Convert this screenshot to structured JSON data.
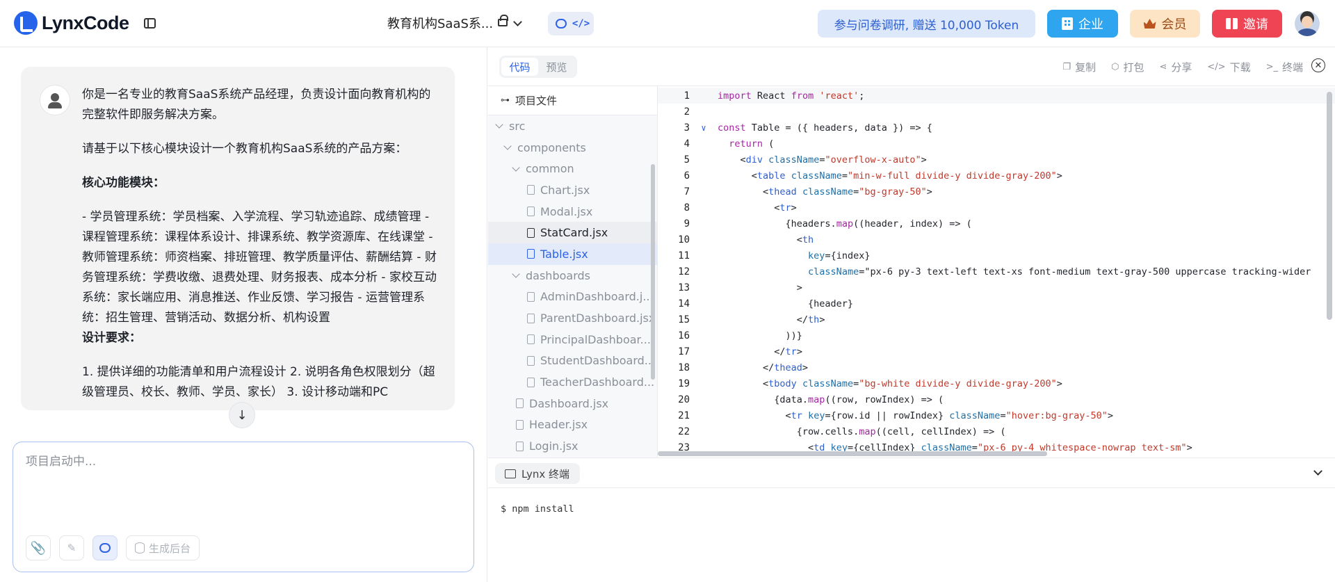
{
  "header": {
    "logo_text": "LynxCode",
    "project_title": "教育机构SaaS系...",
    "survey_text": "参与问卷调研, 赠送 10,000 Token",
    "enterprise_label": "企业",
    "member_label": "会员",
    "invite_label": "邀请"
  },
  "chat": {
    "message": {
      "p1": "你是一名专业的教育SaaS系统产品经理，负责设计面向教育机构的完整软件即服务解决方案。",
      "p2": "请基于以下核心模块设计一个教育机构SaaS系统的产品方案：",
      "p3": "核心功能模块：",
      "p4": "- 学员管理系统：学员档案、入学流程、学习轨迹追踪、成绩管理 - 课程管理系统：课程体系设计、排课系统、教学资源库、在线课堂 - 教师管理系统：师资档案、排班管理、教学质量评估、薪酬结算 - 财务管理系统：学费收缴、退费处理、财务报表、成本分析 - 家校互动系统：家长端应用、消息推送、作业反馈、学习报告 - 运营管理系统：招生管理、营销活动、数据分析、机构设置",
      "p5": "设计要求：",
      "p6": "1. 提供详细的功能清单和用户流程设计 2. 说明各角色权限划分（超级管理员、校长、教师、学员、家长） 3. 设计移动端和PC"
    },
    "composer_placeholder": "项目启动中...",
    "backend_button_label": "生成后台"
  },
  "code_panel": {
    "tabs": [
      "代码",
      "预览"
    ],
    "actions": [
      "复制",
      "打包",
      "分享",
      "下载",
      "终端"
    ],
    "tree_title": "项目文件",
    "tree": [
      {
        "label": "src",
        "type": "folder",
        "depth": 0
      },
      {
        "label": "components",
        "type": "folder",
        "depth": 1
      },
      {
        "label": "common",
        "type": "folder",
        "depth": 2
      },
      {
        "label": "Chart.jsx",
        "type": "file",
        "depth": 3
      },
      {
        "label": "Modal.jsx",
        "type": "file",
        "depth": 3
      },
      {
        "label": "StatCard.jsx",
        "type": "file",
        "depth": 3,
        "state": "hover"
      },
      {
        "label": "Table.jsx",
        "type": "file",
        "depth": 3,
        "state": "selected"
      },
      {
        "label": "dashboards",
        "type": "folder",
        "depth": 2
      },
      {
        "label": "AdminDashboard.j...",
        "type": "file",
        "depth": 3
      },
      {
        "label": "ParentDashboard.jsx",
        "type": "file",
        "depth": 3
      },
      {
        "label": "PrincipalDashboar...",
        "type": "file",
        "depth": 3
      },
      {
        "label": "StudentDashboard...",
        "type": "file",
        "depth": 3
      },
      {
        "label": "TeacherDashboard...",
        "type": "file",
        "depth": 3
      },
      {
        "label": "Dashboard.jsx",
        "type": "file",
        "depth": 2
      },
      {
        "label": "Header.jsx",
        "type": "file",
        "depth": 2
      },
      {
        "label": "Login.jsx",
        "type": "file",
        "depth": 2
      }
    ],
    "code_lines": [
      "import React from 'react';",
      "",
      "const Table = ({ headers, data }) => {",
      "  return (",
      "    <div className=\"overflow-x-auto\">",
      "      <table className=\"min-w-full divide-y divide-gray-200\">",
      "        <thead className=\"bg-gray-50\">",
      "          <tr>",
      "            {headers.map((header, index) => (",
      "              <th",
      "                key={index}",
      "                className=\"px-6 py-3 text-left text-xs font-medium text-gray-500 uppercase tracking-wider",
      "              >",
      "                {header}",
      "              </th>",
      "            ))}",
      "          </tr>",
      "        </thead>",
      "        <tbody className=\"bg-white divide-y divide-gray-200\">",
      "          {data.map((row, rowIndex) => (",
      "            <tr key={row.id || rowIndex} className=\"hover:bg-gray-50\">",
      "              {row.cells.map((cell, cellIndex) => (",
      "                <td key={cellIndex} className=\"px-6 py-4 whitespace-nowrap text-sm\">"
    ],
    "terminal_tab_label": "Lynx 终端",
    "terminal_output": "$ npm install"
  }
}
